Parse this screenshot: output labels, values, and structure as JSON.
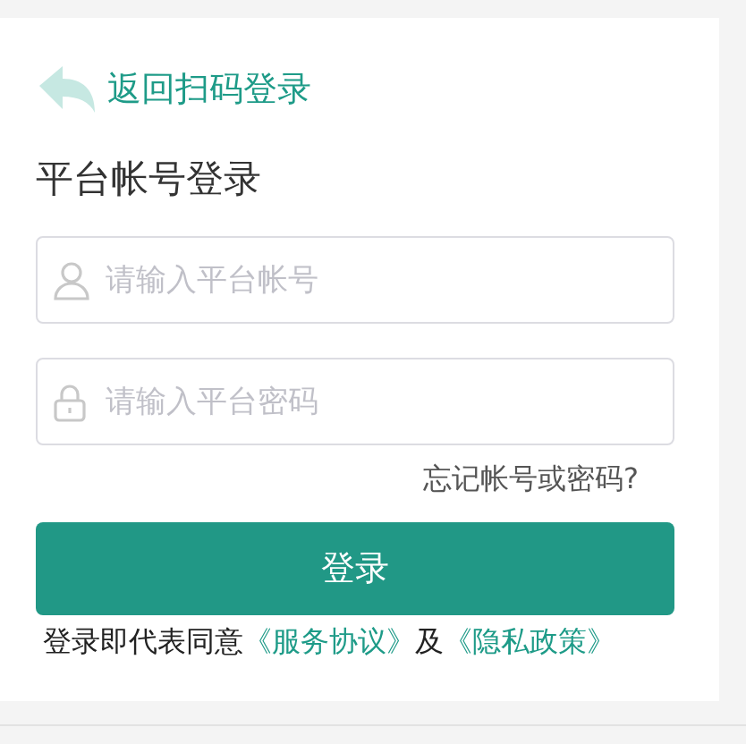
{
  "back_link": {
    "label": "返回扫码登录"
  },
  "title": "平台帐号登录",
  "fields": [
    {
      "kind": "account",
      "placeholder": "请输入平台帐号"
    },
    {
      "kind": "password",
      "placeholder": "请输入平台密码"
    }
  ],
  "forgot_link": "忘记帐号或密码?",
  "login_button": "登录",
  "agreement": [
    {
      "kind": "text",
      "text": "登录即代表同意"
    },
    {
      "kind": "link",
      "text": "《服务协议》"
    },
    {
      "kind": "text",
      "text": "及"
    },
    {
      "kind": "link",
      "text": "《隐私政策》"
    }
  ]
}
